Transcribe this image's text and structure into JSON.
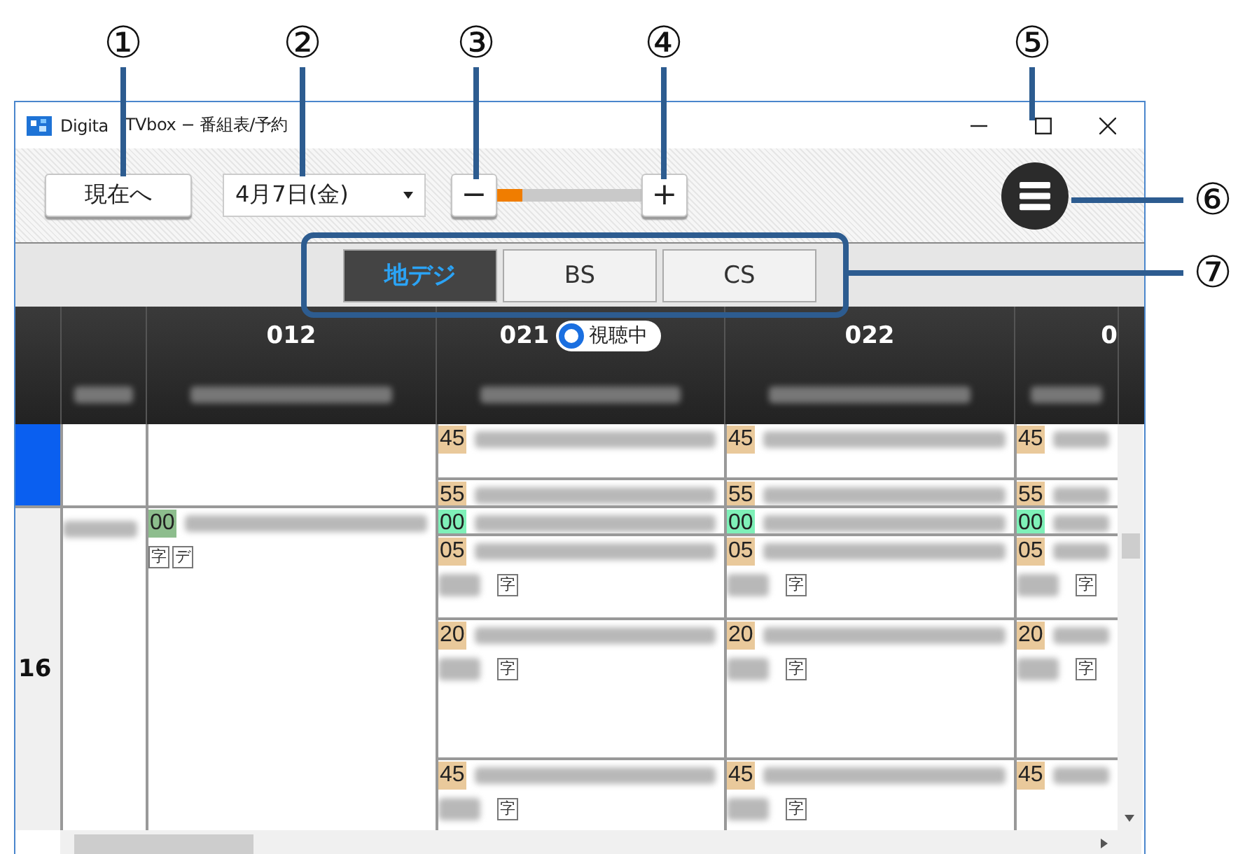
{
  "callouts": [
    "①",
    "②",
    "③",
    "④",
    "⑤",
    "⑥",
    "⑦"
  ],
  "window": {
    "title": [
      "Digita",
      "TVbox − 番組表/予約"
    ]
  },
  "toolbar": {
    "now_button": "現在へ",
    "date": "4月7日(金)",
    "zoom_out": "−",
    "zoom": {
      "level": 0.17
    },
    "zoom_in": "+"
  },
  "tabs": [
    {
      "label": "地デジ",
      "selected": true
    },
    {
      "label": "BS",
      "selected": false
    },
    {
      "label": "CS",
      "selected": false
    }
  ],
  "hours": [
    {
      "current": true
    },
    {
      "label": "16",
      "current": false
    }
  ],
  "channels": [
    {
      "watching": false,
      "programs": [
        {
          "kind": "untimed"
        }
      ]
    },
    {
      "number": "012",
      "watching": false,
      "programs": [
        {
          "kind": "timed",
          "minute": "00",
          "color": "#8dbd8d",
          "tags": [
            "字",
            "デ"
          ]
        }
      ]
    },
    {
      "number": "021",
      "watching": true,
      "badge": "視聴中",
      "programs": [
        {
          "kind": "timed",
          "minute": "45",
          "color": "#e9c99b"
        },
        {
          "kind": "timed",
          "minute": "55",
          "color": "#e9c99b"
        },
        {
          "kind": "timed",
          "minute": "00",
          "color": "#7ff0b8"
        },
        {
          "kind": "timed",
          "minute": "05",
          "color": "#e9c99b",
          "tags": [
            "字"
          ]
        },
        {
          "kind": "timed",
          "minute": "20",
          "color": "#e9c99b",
          "tags": [
            "字"
          ]
        },
        {
          "kind": "timed",
          "minute": "45",
          "color": "#e9c99b",
          "tags": [
            "字"
          ]
        }
      ]
    },
    {
      "number": "022",
      "watching": false,
      "programs": [
        {
          "kind": "timed",
          "minute": "45",
          "color": "#e9c99b"
        },
        {
          "kind": "timed",
          "minute": "55",
          "color": "#e9c99b"
        },
        {
          "kind": "timed",
          "minute": "00",
          "color": "#7ff0b8"
        },
        {
          "kind": "timed",
          "minute": "05",
          "color": "#e9c99b",
          "tags": [
            "字"
          ]
        },
        {
          "kind": "timed",
          "minute": "20",
          "color": "#e9c99b",
          "tags": [
            "字"
          ]
        },
        {
          "kind": "timed",
          "minute": "45",
          "color": "#e9c99b",
          "tags": [
            "字"
          ]
        }
      ]
    },
    {
      "number": "0",
      "watching": false,
      "programs": [
        {
          "kind": "timed",
          "minute": "45",
          "color": "#e9c99b"
        },
        {
          "kind": "timed",
          "minute": "55",
          "color": "#e9c99b"
        },
        {
          "kind": "timed",
          "minute": "00",
          "color": "#7ff0b8"
        },
        {
          "kind": "timed",
          "minute": "05",
          "color": "#e9c99b",
          "tags": [
            "字"
          ]
        },
        {
          "kind": "timed",
          "minute": "20",
          "color": "#e9c99b",
          "tags": [
            "字"
          ]
        },
        {
          "kind": "timed",
          "minute": "45",
          "color": "#e9c99b"
        }
      ]
    }
  ]
}
